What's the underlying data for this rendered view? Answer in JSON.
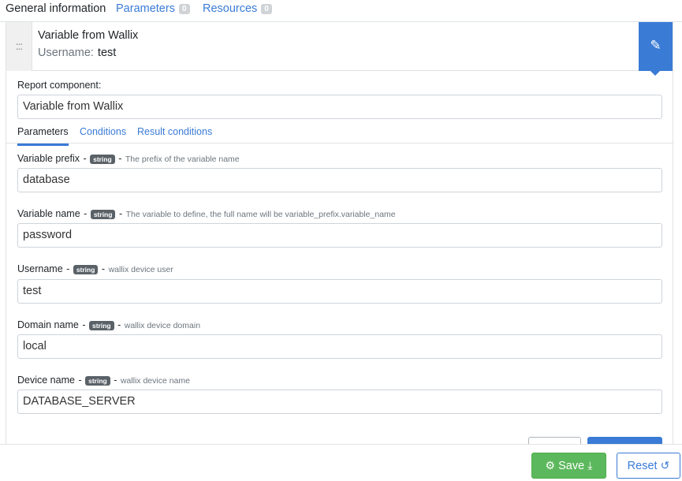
{
  "top_tabs": [
    {
      "label": "General information",
      "active": true
    },
    {
      "label": "Parameters",
      "count": "0"
    },
    {
      "label": "Resources",
      "count": "0"
    }
  ],
  "component": {
    "drag_glyph": ":::",
    "title": "Variable from Wallix",
    "sub_key": "Username:",
    "sub_value": "test",
    "edit_icon": "✎"
  },
  "report_component": {
    "label": "Report component:",
    "value": "Variable from Wallix"
  },
  "inner_tabs": [
    {
      "label": "Parameters",
      "active": true
    },
    {
      "label": "Conditions"
    },
    {
      "label": "Result conditions"
    }
  ],
  "fields": [
    {
      "label": "Variable prefix",
      "type": "string",
      "desc": "The prefix of the variable name",
      "value": "database"
    },
    {
      "label": "Variable name",
      "type": "string",
      "desc": "The variable to define, the full name will be variable_prefix.variable_name",
      "value": "password"
    },
    {
      "label": "Username",
      "type": "string",
      "desc": "wallix device user",
      "value": "test"
    },
    {
      "label": "Domain name",
      "type": "string",
      "desc": "wallix device domain",
      "value": "local"
    },
    {
      "label": "Device name",
      "type": "string",
      "desc": "wallix device name",
      "value": "DATABASE_SERVER"
    }
  ],
  "separator": "-",
  "footer": {
    "save_label": "Save",
    "save_icon_left": "⚙",
    "save_icon_right": "⤓",
    "reset_label": "Reset",
    "reset_icon": "↺"
  },
  "colors": {
    "primary": "#3a7bd5",
    "success": "#5cb85c",
    "badge": "#5a6268"
  }
}
